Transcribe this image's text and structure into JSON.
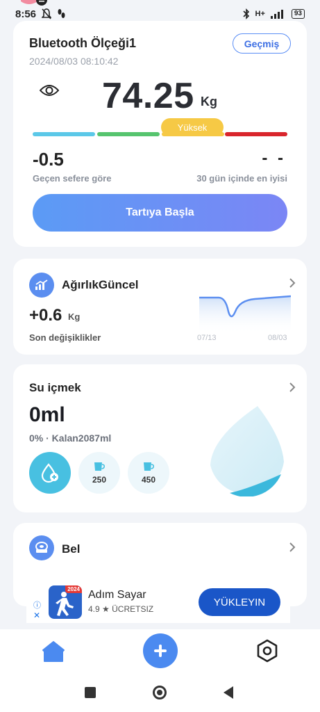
{
  "status_bar": {
    "time": "8:56",
    "battery": "93",
    "network": "H+"
  },
  "scale": {
    "device_name": "Bluetooth Ölçeği1",
    "datetime": "2024/08/03 08:10:42",
    "history_label": "Geçmiş",
    "weight": "74.25",
    "unit": "Kg",
    "bmi_status": "Yüksek",
    "change_value": "-0.5",
    "change_label": "Geçen sefere göre",
    "best_value": "- -",
    "best_label": "30 gün içinde en iyisi",
    "start_label": "Tartıya Başla"
  },
  "weight_trend": {
    "title": "AğırlıkGüncel",
    "value": "+0.6",
    "unit": "Kg",
    "label": "Son değişiklikler",
    "start_tick": "07/13",
    "end_tick": "08/03"
  },
  "water": {
    "title": "Su içmek",
    "amount": "0ml",
    "remaining": "0% · Kalan2087ml",
    "cups": [
      "250",
      "450"
    ]
  },
  "waist": {
    "title": "Bel"
  },
  "ad": {
    "app_name": "Adım Sayar",
    "rating": "4.9 ★  ÜCRETSIZ",
    "icon_badge": "2024",
    "cta": "YÜKLEYIN",
    "info": "ⓘ",
    "close": "✕"
  },
  "colors": {
    "accent": "#5b8ef0",
    "bmi_low": "#5bc8e8",
    "bmi_normal": "#56c46e",
    "bmi_high": "#f6c945",
    "bmi_obese": "#d9252c",
    "water": "#48c0e1"
  }
}
